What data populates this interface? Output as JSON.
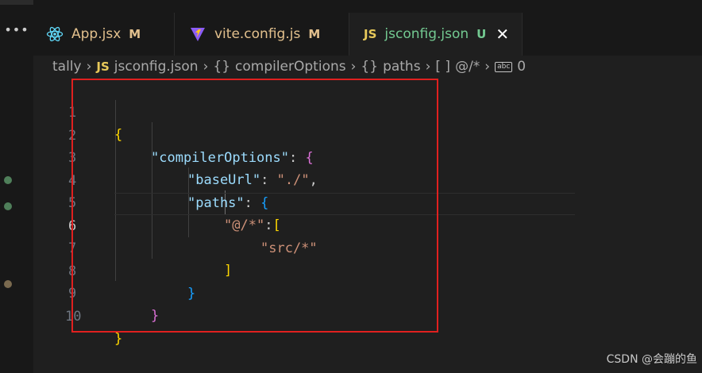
{
  "tabs": [
    {
      "label": "App.jsx",
      "badge": "M",
      "icon": "react-icon",
      "color": "#61dafb"
    },
    {
      "label": "vite.config.js",
      "badge": "M",
      "icon": "vite-icon"
    },
    {
      "label": "jsconfig.json",
      "badge": "U",
      "icon": "json-js-icon",
      "active": true
    }
  ],
  "breadcrumb": {
    "root": "tally",
    "file_icon": "JS",
    "file": "jsconfig.json",
    "seg1_icon": "{}",
    "seg1": "compilerOptions",
    "seg2_icon": "{}",
    "seg2": "paths",
    "seg3_icon": "[ ]",
    "seg3": "@/*",
    "seg4": "0"
  },
  "editor": {
    "line_numbers": [
      "1",
      "2",
      "3",
      "4",
      "5",
      "6",
      "7",
      "8",
      "9",
      "10"
    ],
    "active_line": 6,
    "code": {
      "l1_open": "{",
      "l2_key": "\"compilerOptions\"",
      "l2_colon": ": ",
      "l2_open": "{",
      "l3_key": "\"baseUrl\"",
      "l3_colon": ": ",
      "l3_val": "\"./\"",
      "l3_comma": ",",
      "l4_key": "\"paths\"",
      "l4_colon": ": ",
      "l4_open": "{",
      "l5_key": "\"@/*\"",
      "l5_colon": ":",
      "l5_open": "[",
      "l6_val": "\"src/*\"",
      "l7_close": "]",
      "l8_close": "}",
      "l9_close": "}",
      "l10_close": "}"
    }
  },
  "watermark": "CSDN @会蹦的鱼",
  "colors": {
    "highlight_box": "#e0201f",
    "modified_badge": "#e2c08d",
    "untracked_badge": "#73c991"
  }
}
